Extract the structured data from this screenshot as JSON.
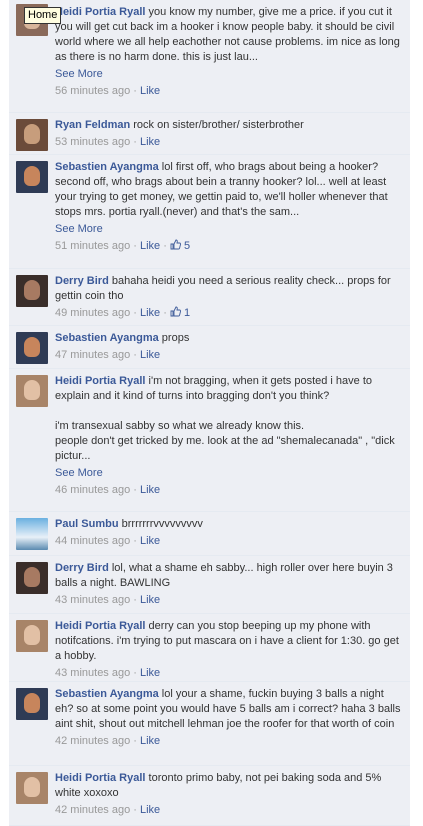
{
  "tooltip": "Home",
  "like_label": "Like",
  "see_more_label": "See More",
  "comments": [
    {
      "author": "Heidi Portia Ryall",
      "text": "you know my number, give me a price. if you cut it you will get cut back im a hooker i know people baby. it should be civil world where we all help eachother not cause problems. im nice as long as there is no harm done. this is just lau...",
      "see_more": true,
      "time": "56 minutes ago",
      "likes": ""
    },
    {
      "author": "Ryan Feldman",
      "text": "rock on sister/brother/ sisterbrother",
      "see_more": false,
      "time": "53 minutes ago",
      "likes": ""
    },
    {
      "author": "Sebastien Ayangma",
      "text": "lol first off, who brags about being a hooker? second off, who brags about bein a tranny hooker? lol... well at least your trying to get money, we gettin paid to, we'll holler whenever that stops mrs. portia ryall.(never) and that's the sam...",
      "see_more": true,
      "time": "51 minutes ago",
      "likes": "5"
    },
    {
      "author": "Derry Bird",
      "text": "bahaha heidi you need a serious reality check... props for gettin coin tho",
      "see_more": false,
      "time": "49 minutes ago",
      "likes": "1"
    },
    {
      "author": "Sebastien Ayangma",
      "text": "props",
      "see_more": false,
      "time": "47 minutes ago",
      "likes": ""
    },
    {
      "author": "Heidi Portia Ryall",
      "text": "i'm not bragging, when it gets posted i have to explain and it kind of turns into bragging don't you think?\n\ni'm transexual sabby so what we already know this.\npeople don't get tricked by me. look at the ad \"shemalecanada\" , \"dick pictur...",
      "see_more": true,
      "time": "46 minutes ago",
      "likes": ""
    },
    {
      "author": "Paul Sumbu",
      "text": "brrrrrrrvvvvvvvvv",
      "see_more": false,
      "time": "44 minutes ago",
      "likes": ""
    },
    {
      "author": "Derry Bird",
      "text": "lol, what a shame eh sabby... high roller over here buyin 3 balls a night. BAWLING",
      "see_more": false,
      "time": "43 minutes ago",
      "likes": ""
    },
    {
      "author": "Heidi Portia Ryall",
      "text": "derry can you stop beeping up my phone with notifcations. i'm trying to put mascara on i have a client for 1:30. go get a hobby.",
      "see_more": false,
      "time": "43 minutes ago",
      "likes": ""
    },
    {
      "author": "Sebastien Ayangma",
      "text": "lol your a shame, fuckin buying 3 balls a night eh? so at some point you would have 5 balls am i correct? haha 3 balls aint shit, shout out mitchell lehman joe the roofer for that worth of coin",
      "see_more": false,
      "time": "42 minutes ago",
      "likes": ""
    },
    {
      "author": "Heidi Portia Ryall",
      "text": "toronto primo baby, not pei baking soda and 5% white xoxoxo",
      "see_more": false,
      "time": "42 minutes ago",
      "likes": ""
    }
  ],
  "colors": {
    "link": "#3b5998",
    "meta": "#999999",
    "background": "#edeff4"
  }
}
